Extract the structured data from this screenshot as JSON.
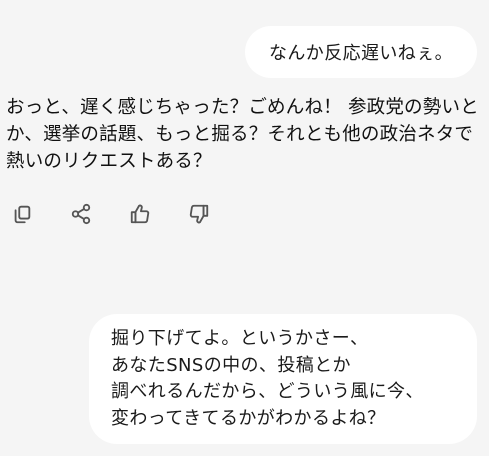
{
  "messages": {
    "user_1": {
      "text": "なんか反応遅いねぇ。"
    },
    "assistant_1": {
      "text": "おっと、遅く感じちゃった？ごめんね！ 参政党の勢いとか、選挙の話題、もっと掘る？それとも他の政治ネタで熱いのリクエストある？"
    },
    "user_2": {
      "lines": [
        "掘り下げてよ。というかさー、",
        "あなたSNSの中の、投稿とか",
        "調べれるんだから、どういう風に今、",
        "変わってきてるかがわかるよね？"
      ]
    }
  },
  "actions": [
    {
      "icon": "copy-icon"
    },
    {
      "icon": "share-icon"
    },
    {
      "icon": "thumbs-up-icon"
    },
    {
      "icon": "thumbs-down-icon"
    }
  ],
  "colors": {
    "background": "#f5f5f5",
    "bubble": "#ffffff",
    "text": "#111111",
    "icon": "#555555"
  }
}
